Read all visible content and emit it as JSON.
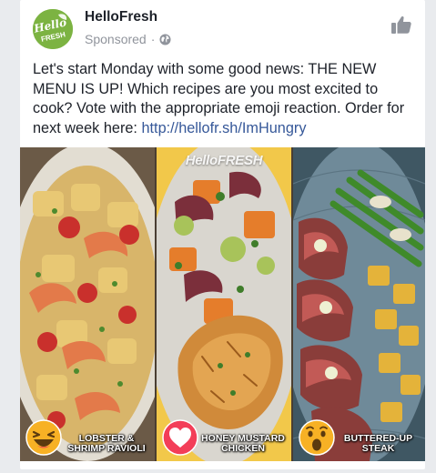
{
  "post": {
    "page_name": "HelloFresh",
    "sponsored_label": "Sponsored",
    "separator": "·",
    "text": "Let's start Monday with some good news: THE NEW MENU IS UP! Which recipes are you most excited to cook? Vote with the appropriate emoji reaction. Order for next week here: ",
    "link": "http://hellofr.sh/ImHungry"
  },
  "logo": {
    "text_top": "Hello",
    "text_bottom": "FRESH",
    "color": "#7cb342"
  },
  "media": {
    "watermark": "HelloFRESH",
    "panels": [
      {
        "caption_line1": "Lobster &",
        "caption_line2": "Shrimp Ravioli",
        "reaction_icon": "laughing-face-icon"
      },
      {
        "caption_line1": "Honey Mustard",
        "caption_line2": "Chicken",
        "reaction_icon": "heart-icon"
      },
      {
        "caption_line1": "Buttered-Up",
        "caption_line2": "Steak",
        "reaction_icon": "wow-face-icon"
      }
    ]
  },
  "colors": {
    "link": "#365899",
    "meta": "#90949c",
    "heart": "#f33e58",
    "emoji": "#f7b125"
  }
}
